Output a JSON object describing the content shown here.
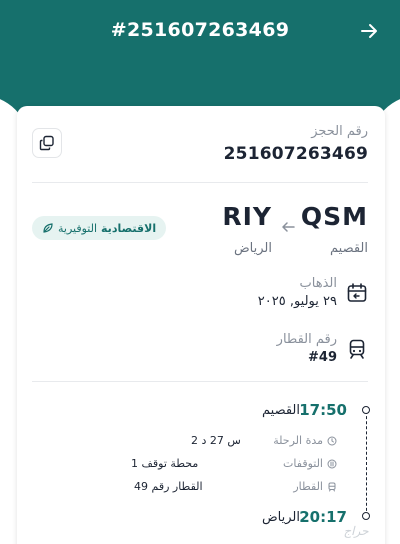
{
  "header": {
    "title": "#251607263469"
  },
  "booking": {
    "label": "رقم الحجز",
    "number": "251607263469"
  },
  "route": {
    "origin_code": "QSM",
    "origin_name": "القصيم",
    "dest_code": "RIY",
    "dest_name": "الرياض"
  },
  "fare": {
    "class": "الاقتصادية",
    "type": "التوفيرية"
  },
  "departure": {
    "label": "الذهاب",
    "date": "٢٩ يوليو, ٢٠٢٥"
  },
  "train": {
    "label": "رقم القطار",
    "number": "#49"
  },
  "timeline": {
    "dep_time": "17:50",
    "dep_station": "القصيم",
    "arr_time": "20:17",
    "arr_station": "الرياض",
    "details": [
      {
        "label": "مدة الرحلة",
        "value": "2 س 27 د",
        "icon": "clock-icon"
      },
      {
        "label": "التوقفات",
        "value": "1 محطة توقف",
        "icon": "stops-icon"
      },
      {
        "label": "القطار",
        "value": "القطار رقم 49",
        "icon": "train-icon"
      }
    ]
  },
  "colors": {
    "primary": "#16706c",
    "badge_bg": "#e6f3f1"
  }
}
